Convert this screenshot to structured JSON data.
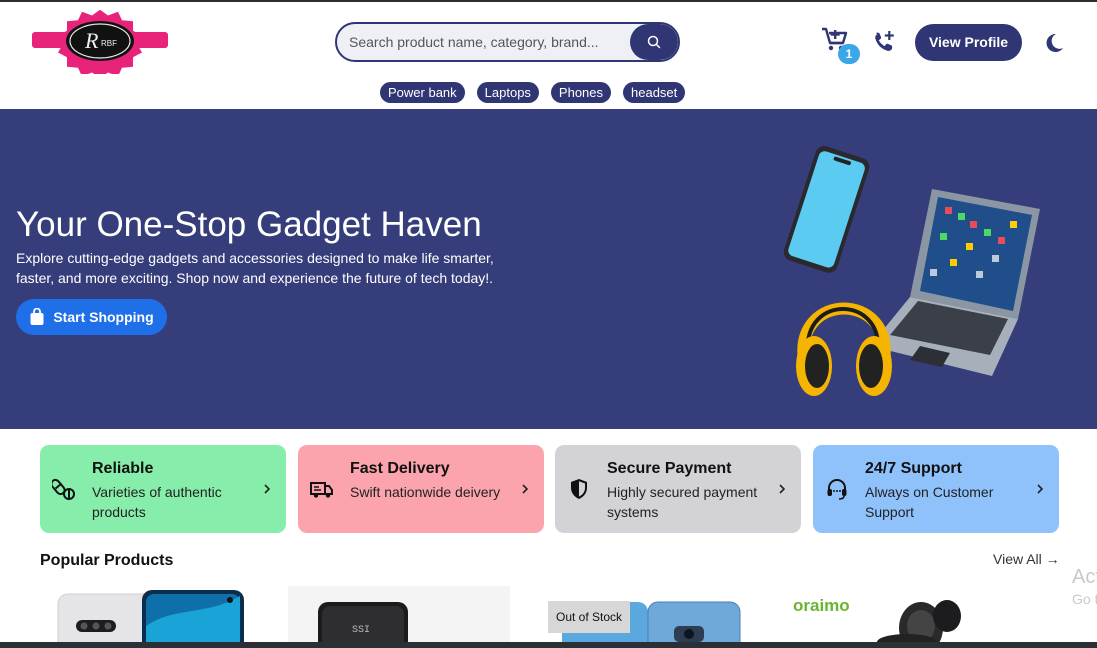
{
  "header": {
    "logo_text": "RBF",
    "search": {
      "placeholder": "Search product name, category, brand..."
    },
    "cart": {
      "count": "1"
    },
    "view_profile_label": "View Profile",
    "quick_categories": [
      "Power bank",
      "Laptops",
      "Phones",
      "headset"
    ]
  },
  "hero": {
    "title": "Your One-Stop Gadget Haven",
    "description": "Explore cutting-edge gadgets and accessories designed to make life smarter, faster, and more exciting. Shop now and experience the future of tech today!.",
    "cta_label": "Start Shopping"
  },
  "features": [
    {
      "title": "Reliable",
      "description": "Varieties of authentic products",
      "color": "#86eeaa",
      "icon": "pills-icon"
    },
    {
      "title": "Fast Delivery",
      "description": "Swift nationwide deivery",
      "color": "#fba4ad",
      "icon": "truck-icon"
    },
    {
      "title": "Secure Payment",
      "description": "Highly secured payment systems",
      "color": "#d3d3d7",
      "icon": "shield-icon"
    },
    {
      "title": "24/7 Support",
      "description": "Always on Customer Support",
      "color": "#8fc2fb",
      "icon": "headset-icon"
    }
  ],
  "popular": {
    "title": "Popular Products",
    "view_all": "View All →",
    "out_of_stock_label": "Out of Stock",
    "brand_oraimo": "oraimo"
  },
  "watermark": {
    "line1": "Act",
    "line2": "Go t"
  },
  "colors": {
    "primary": "#2f3673",
    "hero_bg": "#353e7a",
    "cta": "#1f6fe8",
    "badge": "#39a7e8"
  }
}
